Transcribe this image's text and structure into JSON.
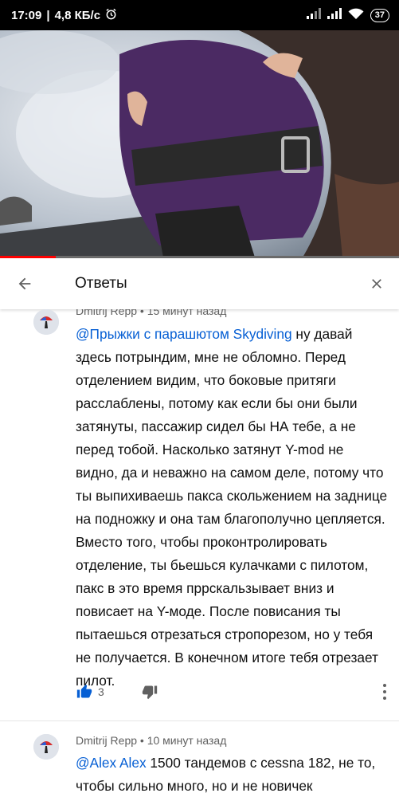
{
  "status_bar": {
    "time": "17:09",
    "network_speed": "4,8 КБ/с",
    "battery": "37",
    "icons": [
      "alarm-icon",
      "signal-icon",
      "signal-icon",
      "wifi-icon",
      "battery-icon"
    ]
  },
  "video": {
    "progress_fraction": 0.14
  },
  "header": {
    "title": "Ответы",
    "back_icon": "arrow-back-icon",
    "close_icon": "close-icon"
  },
  "comments": [
    {
      "author": "Dmitrij Repp",
      "time": "15 минут назад",
      "mention": "@Прыжки с парашютом Skydiving",
      "text": " ну давай здесь потрындим, мне не обломно. Перед отделением видим, что боковые притяги расслаблены, потому как если бы они были затянуты, пассажир сидел бы НА тебе, а не перед тобой. Насколько затянут Y-mod не видно, да и неважно на самом деле, потому что ты выпихиваешь пакса скольжением на заднице на подножку и она там благополучно цепляется. Вместо того, чтобы проконтролировать отделение, ты бьешься кулачками с пилотом, пакс в это время пррскальзывает вниз и повисает на Y-моде. После повисания ты пытаешься отрезаться стропорезом, но у тебя не получается. В конечном итоге тебя отрезает пилот.",
      "likes": "3"
    },
    {
      "author": "Dmitrij Repp",
      "time": "10 минут назад",
      "mention": "@Alex Alex",
      "text": " 1500 тандемов с cessna 182, не то, чтобы сильно много, но и не новичек"
    }
  ]
}
